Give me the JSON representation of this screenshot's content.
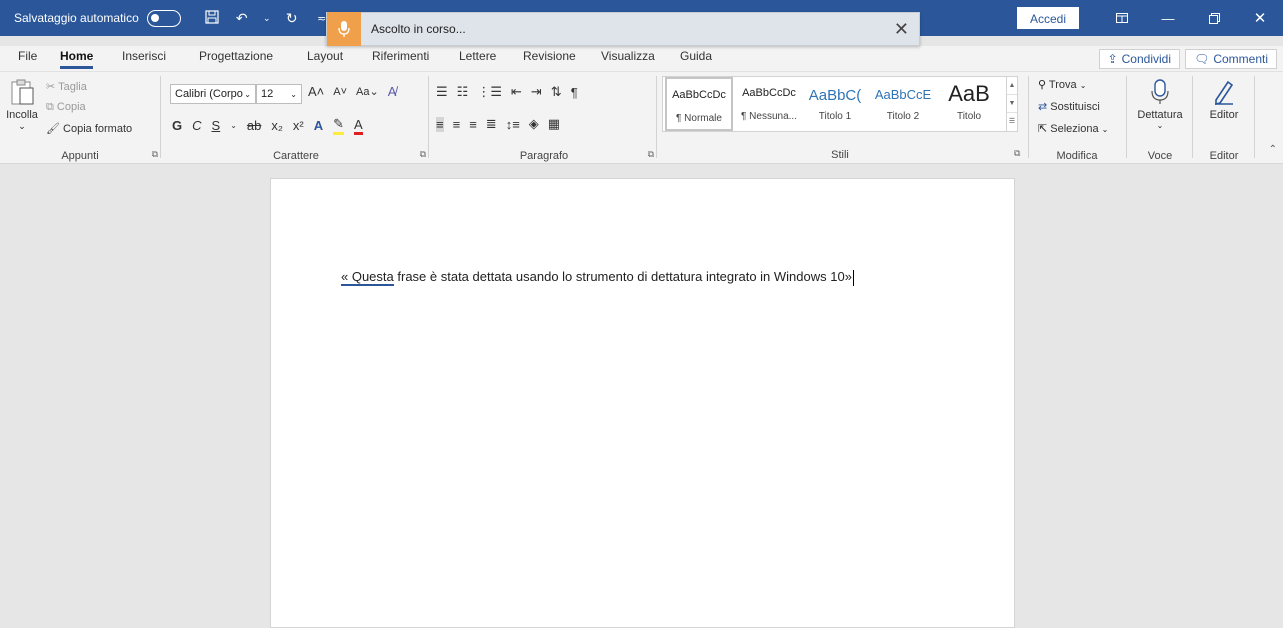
{
  "titlebar": {
    "autosave_label": "Salvataggio automatico",
    "autosave_state": "off",
    "signin_label": "Accedi",
    "bg_color": "#2b579a"
  },
  "dictation": {
    "status": "Ascolto in corso...",
    "mic_color": "#f0a04b"
  },
  "tabs": [
    "File",
    "Home",
    "Inserisci",
    "Progettazione",
    "Layout",
    "Riferimenti",
    "Lettere",
    "Revisione",
    "Visualizza",
    "Guida"
  ],
  "active_tab": "Home",
  "share_label": "Condividi",
  "comments_label": "Commenti",
  "clipboard": {
    "paste": "Incolla",
    "cut": "Taglia",
    "copy": "Copia",
    "format_painter": "Copia formato",
    "group": "Appunti"
  },
  "font": {
    "name": "Calibri (Corpo",
    "size": "12",
    "group": "Carattere"
  },
  "paragraph": {
    "group": "Paragrafo"
  },
  "styles": {
    "items": [
      {
        "preview": "AaBbCcDc",
        "name": "¶ Normale"
      },
      {
        "preview": "AaBbCcDc",
        "name": "¶ Nessuna..."
      },
      {
        "preview": "AaBbC(",
        "name": "Titolo 1"
      },
      {
        "preview": "AaBbCcE",
        "name": "Titolo 2"
      },
      {
        "preview": "AaB",
        "name": "Titolo"
      }
    ],
    "group": "Stili"
  },
  "editing": {
    "find": "Trova",
    "replace": "Sostituisci",
    "select": "Seleziona",
    "group": "Modifica"
  },
  "voice": {
    "dictate": "Dettatura",
    "group": "Voce"
  },
  "editor": {
    "label": "Editor",
    "group": "Editor"
  },
  "document": {
    "text_first": "« Questa",
    "text_rest": " frase è stata dettata usando lo strumento di dettatura integrato in Windows 10»"
  }
}
